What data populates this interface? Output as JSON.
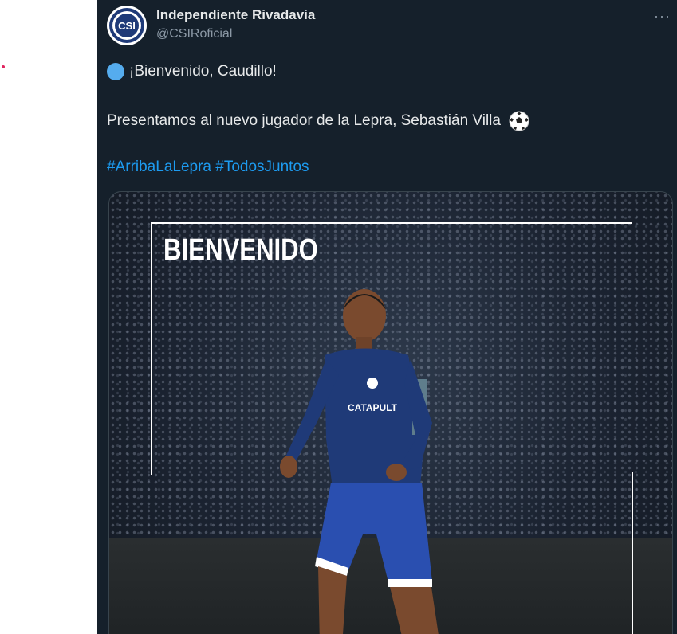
{
  "author": {
    "name": "Independiente Rivadavia",
    "handle": "@CSIRoficial",
    "avatar_icon": "club-crest-icon"
  },
  "menu": {
    "more_label": "···"
  },
  "tweet": {
    "line1": "¡Bienvenido, Caudillo!",
    "line1_icon": "blue-circle-icon",
    "line2": "Presentamos al nuevo jugador de la Lepra, Sebastián Villa",
    "line2_icon": "soccer-ball-icon",
    "hashtags": [
      "#ArribaLaLepra",
      "#TodosJuntos"
    ]
  },
  "media": {
    "headline": "BIENVENIDO",
    "shirt_sponsor": "CATAPULT"
  },
  "colors": {
    "background": "#15202b",
    "text": "#e7e9ea",
    "secondary": "#8b98a5",
    "link": "#1d9bf0",
    "kit": "#1f3a78"
  }
}
